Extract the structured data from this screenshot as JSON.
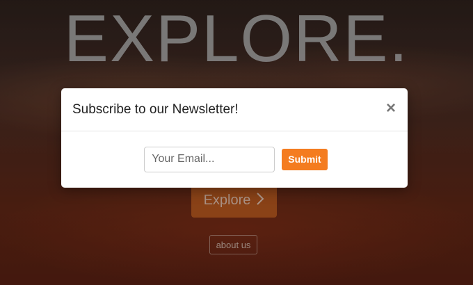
{
  "hero": {
    "title": "EXPLORE.",
    "explore_label": "Explore",
    "explore_icon": "chevron-right-icon",
    "about_label": "about us"
  },
  "modal": {
    "title": "Subscribe to our Newsletter!",
    "close_label": "×",
    "email_placeholder": "Your Email...",
    "email_value": "",
    "submit_label": "Submit"
  },
  "colors": {
    "accent": "#f47c20",
    "explore_button": "#b95a1e"
  }
}
